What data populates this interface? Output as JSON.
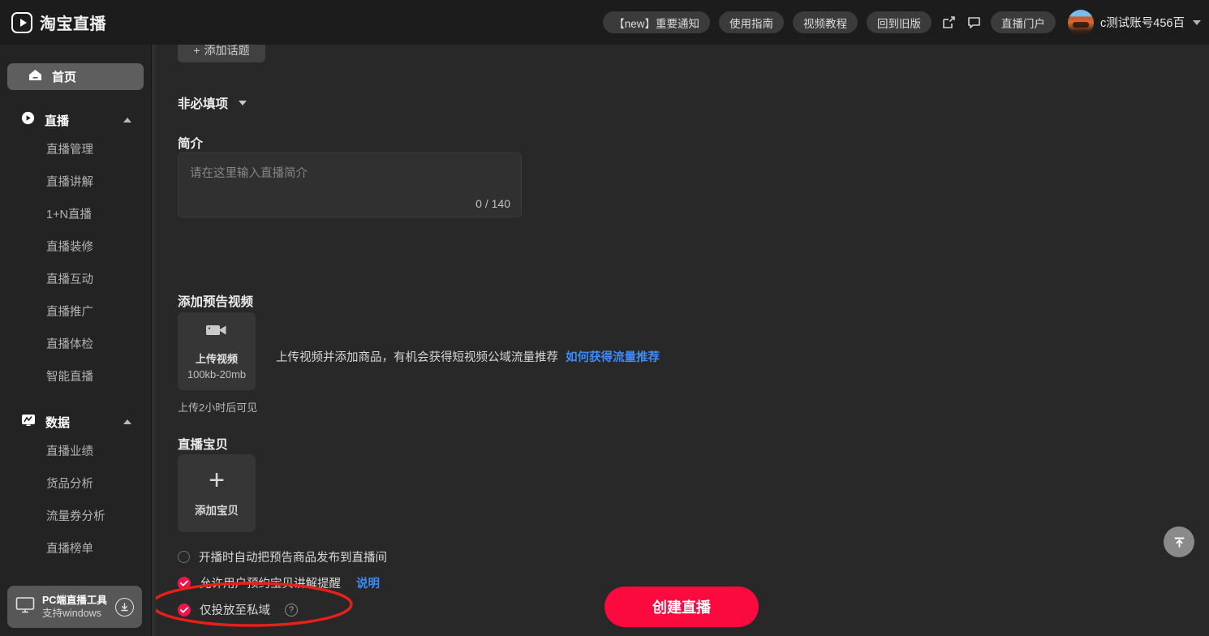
{
  "header": {
    "brand": "淘宝直播",
    "brand_logo_icon": "play-rounded-icon",
    "pills": [
      {
        "label": "【new】重要通知",
        "name": "important-notice"
      },
      {
        "label": "使用指南",
        "name": "usage-guide"
      },
      {
        "label": "视频教程",
        "name": "video-tutorial"
      },
      {
        "label": "回到旧版",
        "name": "back-to-old-version"
      }
    ],
    "icons": [
      {
        "name": "edit-square-icon"
      },
      {
        "name": "chat-bubble-icon"
      }
    ],
    "portal_pill": "直播门户",
    "account_name": "c测试账号456百",
    "account_caret_icon": "chevron-down-icon"
  },
  "sidebar": {
    "home": {
      "label": "首页",
      "icon": "home-icon"
    },
    "groups": [
      {
        "label": "直播",
        "icon": "play-circle-icon",
        "caret": "chevron-up-icon",
        "items": [
          "直播管理",
          "直播讲解",
          "1+N直播",
          "直播装修",
          "直播互动",
          "直播推广",
          "直播体检",
          "智能直播"
        ]
      },
      {
        "label": "数据",
        "icon": "chart-monitor-icon",
        "caret": "chevron-up-icon",
        "items": [
          "直播业绩",
          "货品分析",
          "流量券分析",
          "直播榜单"
        ]
      }
    ],
    "pc_card": {
      "title": "PC端直播工具",
      "subtitle": "支持windows",
      "monitor_icon": "monitor-icon",
      "download_icon": "download-circle-icon"
    }
  },
  "main": {
    "cut_button_label": "添加话题",
    "optional_section": {
      "label": "非必填项",
      "caret_icon": "chevron-down-icon"
    },
    "intro": {
      "label": "简介",
      "placeholder": "请在这里输入直播简介",
      "value": "",
      "counter": "0 / 140"
    },
    "preview_video": {
      "label": "添加预告视频",
      "upload_icon": "video-camera-icon",
      "upload_title": "上传视频",
      "upload_size": "100kb-20mb",
      "hint": "上传2小时后可见",
      "note": "上传视频并添加商品，有机会获得短视频公域流量推荐",
      "link": "如何获得流量推荐"
    },
    "live_goods": {
      "label": "直播宝贝",
      "add_icon": "plus-icon",
      "add_label": "添加宝贝"
    },
    "checkboxes": [
      {
        "label": "开播时自动把预告商品发布到直播间",
        "checked": false,
        "name": "auto-publish-preview-goods"
      },
      {
        "label": "允许用户预约宝贝讲解提醒",
        "checked": true,
        "link": "说明",
        "name": "allow-goods-reminder"
      },
      {
        "label": "仅投放至私域",
        "checked": true,
        "help_icon": "help-circle-icon",
        "name": "private-domain-only"
      }
    ],
    "create_button": "创建直播",
    "to_top_icon": "scroll-to-top-icon"
  },
  "colors": {
    "accent_red": "#fa0a3e",
    "link_blue": "#3c8bfa",
    "annotation_red": "#e8201a",
    "header_bg": "#1c1c1c",
    "sidebar_bg": "#232323",
    "main_bg": "#282828"
  }
}
